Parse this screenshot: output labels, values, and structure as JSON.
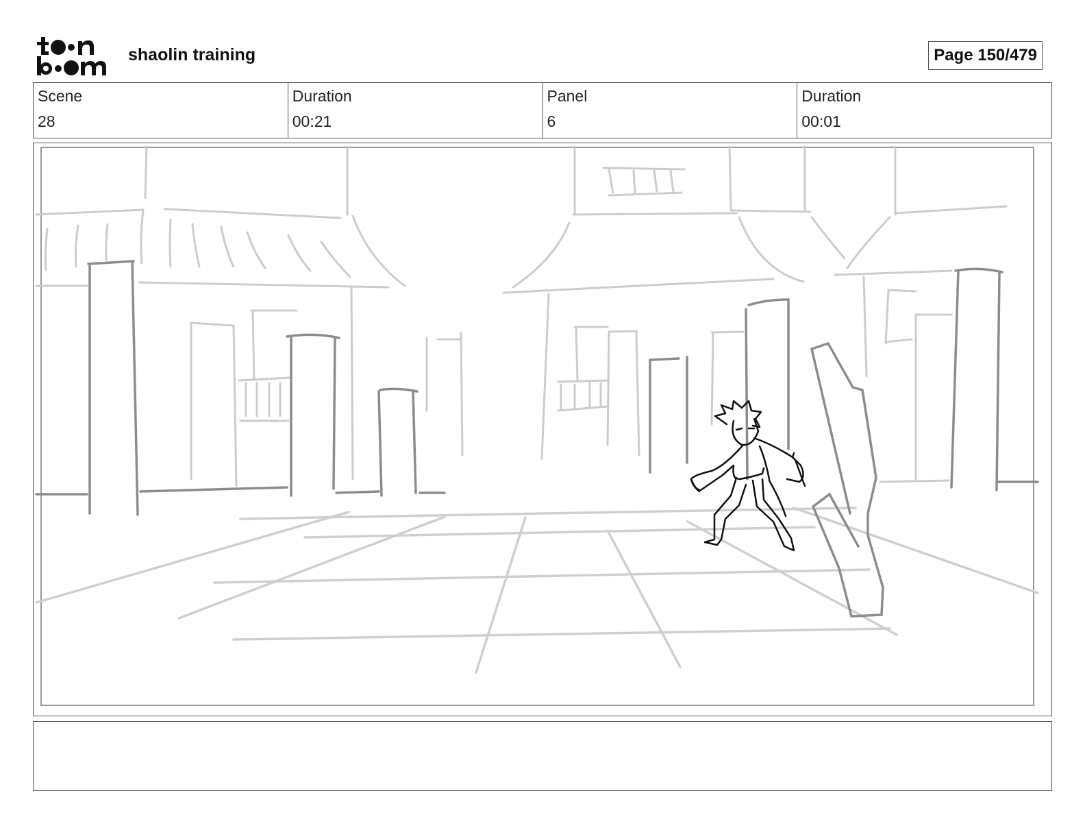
{
  "header": {
    "logo_alt": "toon boom",
    "project_title": "shaolin training",
    "page_number": "Page 150/479"
  },
  "info": [
    {
      "label": "Scene",
      "value": "28"
    },
    {
      "label": "Duration",
      "value": "00:21"
    },
    {
      "label": "Panel",
      "value": "6"
    },
    {
      "label": "Duration",
      "value": "00:01"
    }
  ],
  "notes": {
    "text": ""
  },
  "colors": {
    "border": "#555555",
    "sketch_light": "#c8c8c8",
    "sketch_mid": "#8a8a8a",
    "figure": "#111111"
  }
}
